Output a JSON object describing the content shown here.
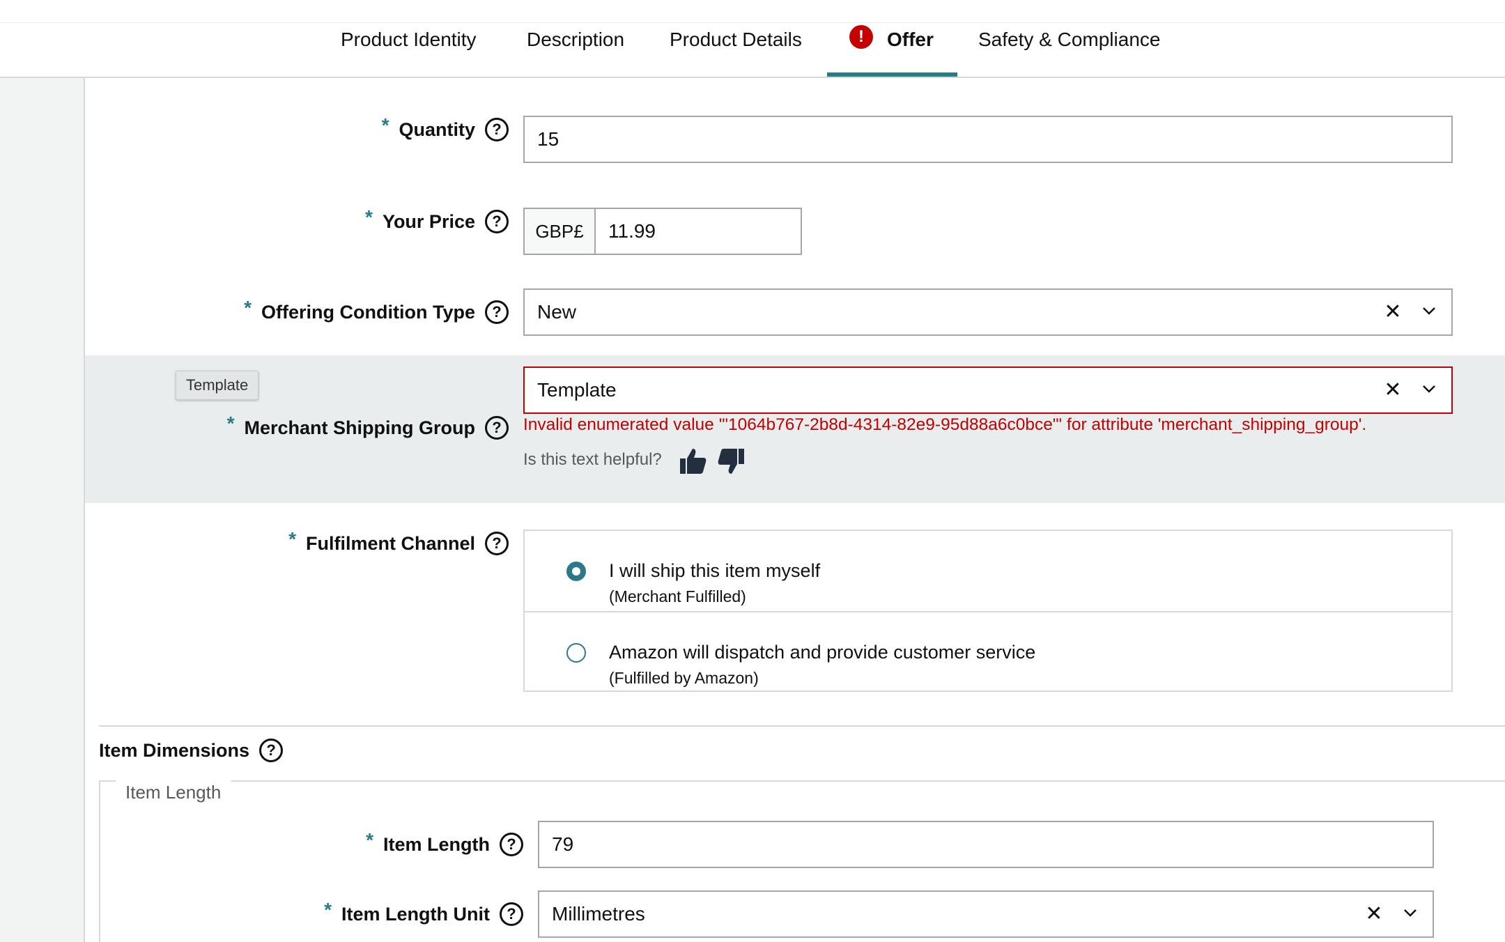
{
  "tabs": [
    {
      "label": "Product Identity",
      "active": false,
      "error": false
    },
    {
      "label": "Description",
      "active": false,
      "error": false
    },
    {
      "label": "Product Details",
      "active": false,
      "error": false
    },
    {
      "label": "Offer",
      "active": true,
      "error": true
    },
    {
      "label": "Safety & Compliance",
      "active": false,
      "error": false
    }
  ],
  "error_icon_glyph": "!",
  "required_marker": "*",
  "help_glyph": "?",
  "colors": {
    "accent": "#2b7a8a",
    "error": "#c40000",
    "band": "#eaeded"
  },
  "form": {
    "quantity": {
      "label": "Quantity",
      "value": "15"
    },
    "price": {
      "label": "Your Price",
      "currency": "GBP£",
      "value": "11.99"
    },
    "condition": {
      "label": "Offering Condition Type",
      "value": "New"
    },
    "shipping_group": {
      "label": "Merchant Shipping Group",
      "value": "Template",
      "tooltip": "Template",
      "error": "Invalid enumerated value '\"1064b767-2b8d-4314-82e9-95d88a6c0bce\"' for attribute 'merchant_shipping_group'.",
      "helpful_prompt": "Is this text helpful?"
    },
    "fulfilment": {
      "label": "Fulfilment Channel",
      "options": [
        {
          "main": "I will ship this item myself",
          "sub": "(Merchant Fulfilled)",
          "checked": true
        },
        {
          "main": "Amazon will dispatch and provide customer service",
          "sub": "(Fulfilled by Amazon)",
          "checked": false
        }
      ]
    }
  },
  "dimensions": {
    "title": "Item Dimensions",
    "group_legend": "Item Length",
    "length": {
      "label": "Item Length",
      "value": "79"
    },
    "length_unit": {
      "label": "Item Length Unit",
      "value": "Millimetres"
    }
  }
}
